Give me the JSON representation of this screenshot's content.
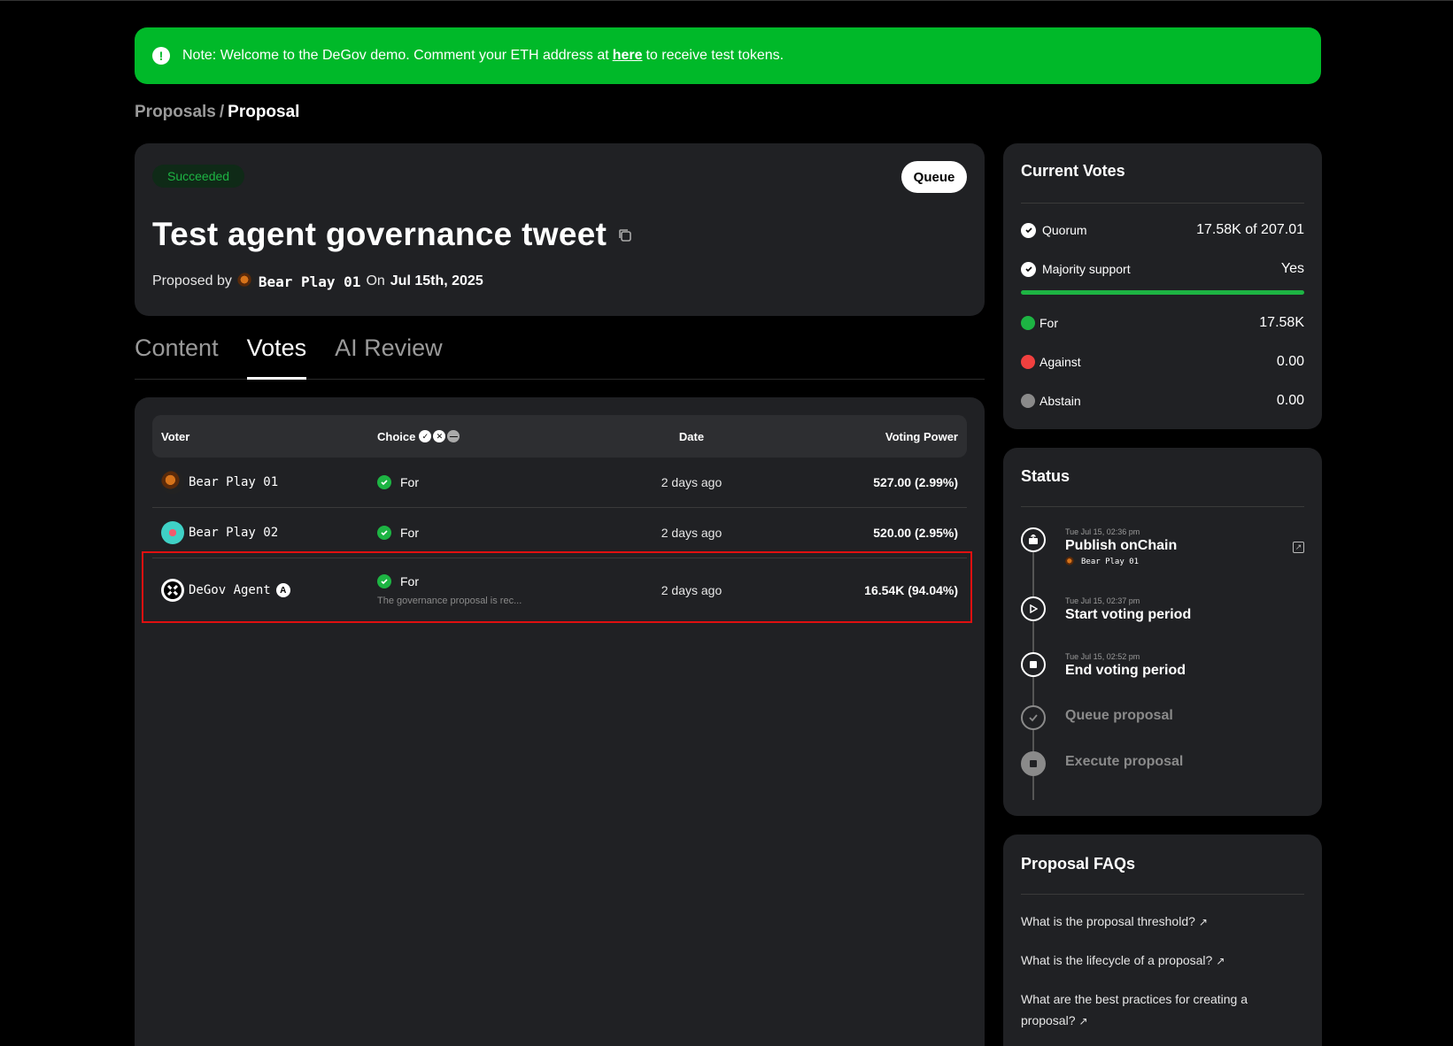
{
  "banner": {
    "prefix": "Note: Welcome to the DeGov demo. Comment your ETH address at",
    "link": "here",
    "suffix": "to receive test tokens."
  },
  "breadcrumb": {
    "parent": "Proposals",
    "separator": "/",
    "current": "Proposal"
  },
  "proposal": {
    "status": "Succeeded",
    "action": "Queue",
    "title": "Test agent governance tweet",
    "proposed_by_label": "Proposed by",
    "proposer": "Bear Play 01",
    "on_label": "On",
    "date": "Jul 15th, 2025"
  },
  "tabs": [
    {
      "label": "Content",
      "active": false
    },
    {
      "label": "Votes",
      "active": true
    },
    {
      "label": "AI Review",
      "active": false
    }
  ],
  "votes_table": {
    "headers": {
      "voter": "Voter",
      "choice": "Choice",
      "date": "Date",
      "power": "Voting Power"
    },
    "rows": [
      {
        "voter": "Bear Play 01",
        "choice": "For",
        "reason": "",
        "date": "2 days ago",
        "power": "527.00 (2.99%)"
      },
      {
        "voter": "Bear Play 02",
        "choice": "For",
        "reason": "",
        "date": "2 days ago",
        "power": "520.00 (2.95%)"
      },
      {
        "voter": "DeGov Agent",
        "choice": "For",
        "reason": "The governance proposal is rec...",
        "date": "2 days ago",
        "power": "16.54K (94.04%)"
      }
    ]
  },
  "current_votes": {
    "title": "Current Votes",
    "quorum_label": "Quorum",
    "quorum_value": "17.58K of 207.01",
    "majority_label": "Majority support",
    "majority_value": "Yes",
    "majority_fill_percent": 100,
    "for_label": "For",
    "for_value": "17.58K",
    "against_label": "Against",
    "against_value": "0.00",
    "abstain_label": "Abstain",
    "abstain_value": "0.00",
    "colors": {
      "for": "#1db443",
      "against": "#f1403f",
      "abstain": "#8a8a8a"
    }
  },
  "status": {
    "title": "Status",
    "steps": [
      {
        "time": "Tue Jul 15, 02:36 pm",
        "label": "Publish onChain",
        "by": "Bear Play 01",
        "icon": "publish-icon"
      },
      {
        "time": "Tue Jul 15, 02:37 pm",
        "label": "Start voting period",
        "icon": "play-icon"
      },
      {
        "time": "Tue Jul 15, 02:52 pm",
        "label": "End voting period",
        "icon": "stop-icon"
      },
      {
        "time": "",
        "label": "Queue proposal",
        "icon": "check-icon"
      },
      {
        "time": "",
        "label": "Execute proposal",
        "icon": "execute-icon"
      }
    ]
  },
  "faqs": {
    "title": "Proposal FAQs",
    "items": [
      "What is the proposal threshold?",
      "What is the lifecycle of a proposal?",
      "What are the best practices for creating a proposal?"
    ]
  }
}
